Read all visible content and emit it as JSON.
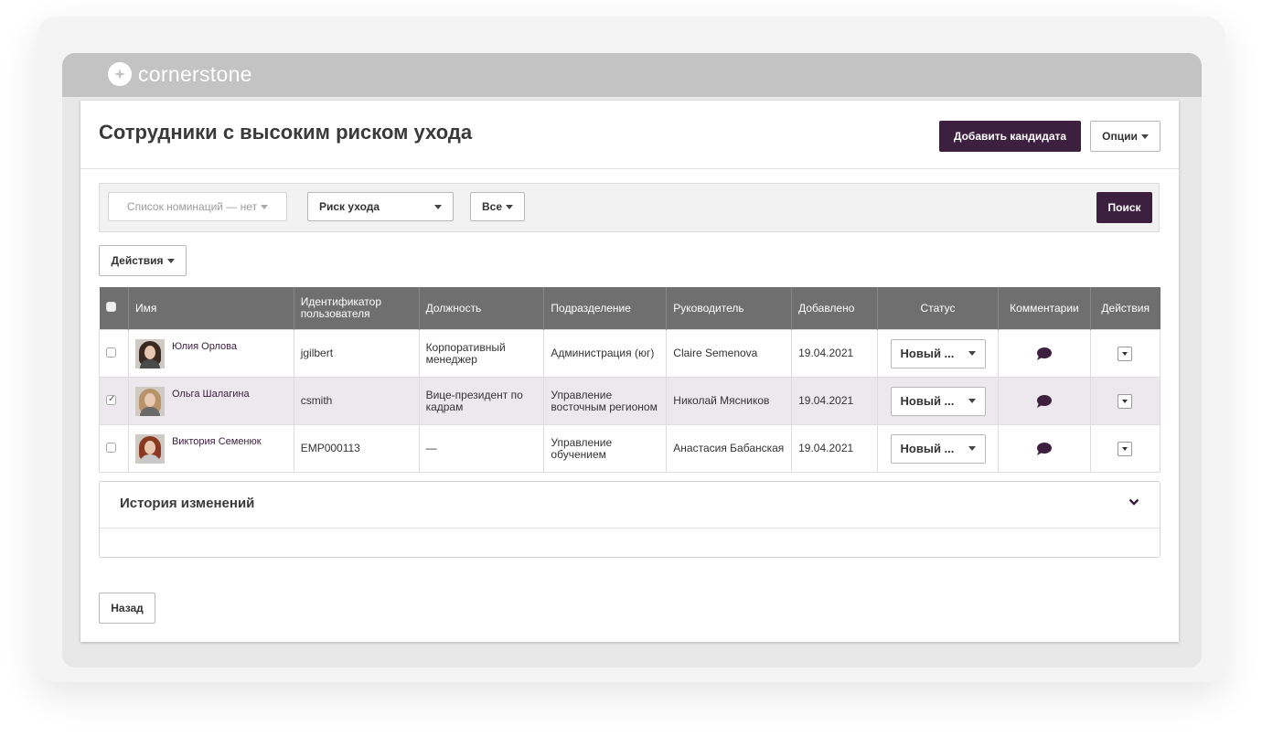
{
  "brand": {
    "name": "cornerstone",
    "icon": "cornerstone-logo-icon"
  },
  "page": {
    "title": "Сотрудники с высоким риском ухода"
  },
  "header_actions": {
    "add_candidate": "Добавить кандидата",
    "options": "Опции"
  },
  "filters": {
    "nomination_list": "Список номинаций — нет",
    "risk": "Риск ухода",
    "scope": "Все",
    "search": "Поиск"
  },
  "bulk_actions": "Действия",
  "table": {
    "columns": [
      "Имя",
      "Идентификатор пользователя",
      "Должность",
      "Подразделение",
      "Руководитель",
      "Добавлено",
      "Статус",
      "Комментарии",
      "Действия"
    ],
    "rows": [
      {
        "name": "Юлия Орлова",
        "user_id": "jgilbert",
        "position": "Корпоративный менеджер",
        "department": "Администрация (юг)",
        "manager": "Claire Semenova",
        "added": "19.04.2021",
        "status": "Новый ...",
        "checked": false,
        "avatar_hair": "#3a2a22",
        "avatar_clothes": "#4a4a4a"
      },
      {
        "name": "Ольга Шалагина",
        "user_id": "csmith",
        "position": "Вице-президент по кадрам",
        "department": "Управление восточным регионом",
        "manager": "Николай Мясников",
        "added": "19.04.2021",
        "status": "Новый ...",
        "checked": true,
        "avatar_hair": "#b89368",
        "avatar_clothes": "#6a6a6a"
      },
      {
        "name": "Виктория Семенюк",
        "user_id": "EMP000113",
        "position": "—",
        "department": "Управление обучением",
        "manager": "Анастасия Бабанская",
        "added": "19.04.2021",
        "status": "Новый ...",
        "checked": false,
        "avatar_hair": "#8a3a22",
        "avatar_clothes": "#c8c8c8"
      }
    ]
  },
  "history": {
    "title": "История изменений"
  },
  "back": "Назад",
  "colors": {
    "accent": "#3d2040",
    "topbar": "#c3c3c3",
    "table_header": "#6f6f6f",
    "selected_row": "#ede7ee"
  }
}
